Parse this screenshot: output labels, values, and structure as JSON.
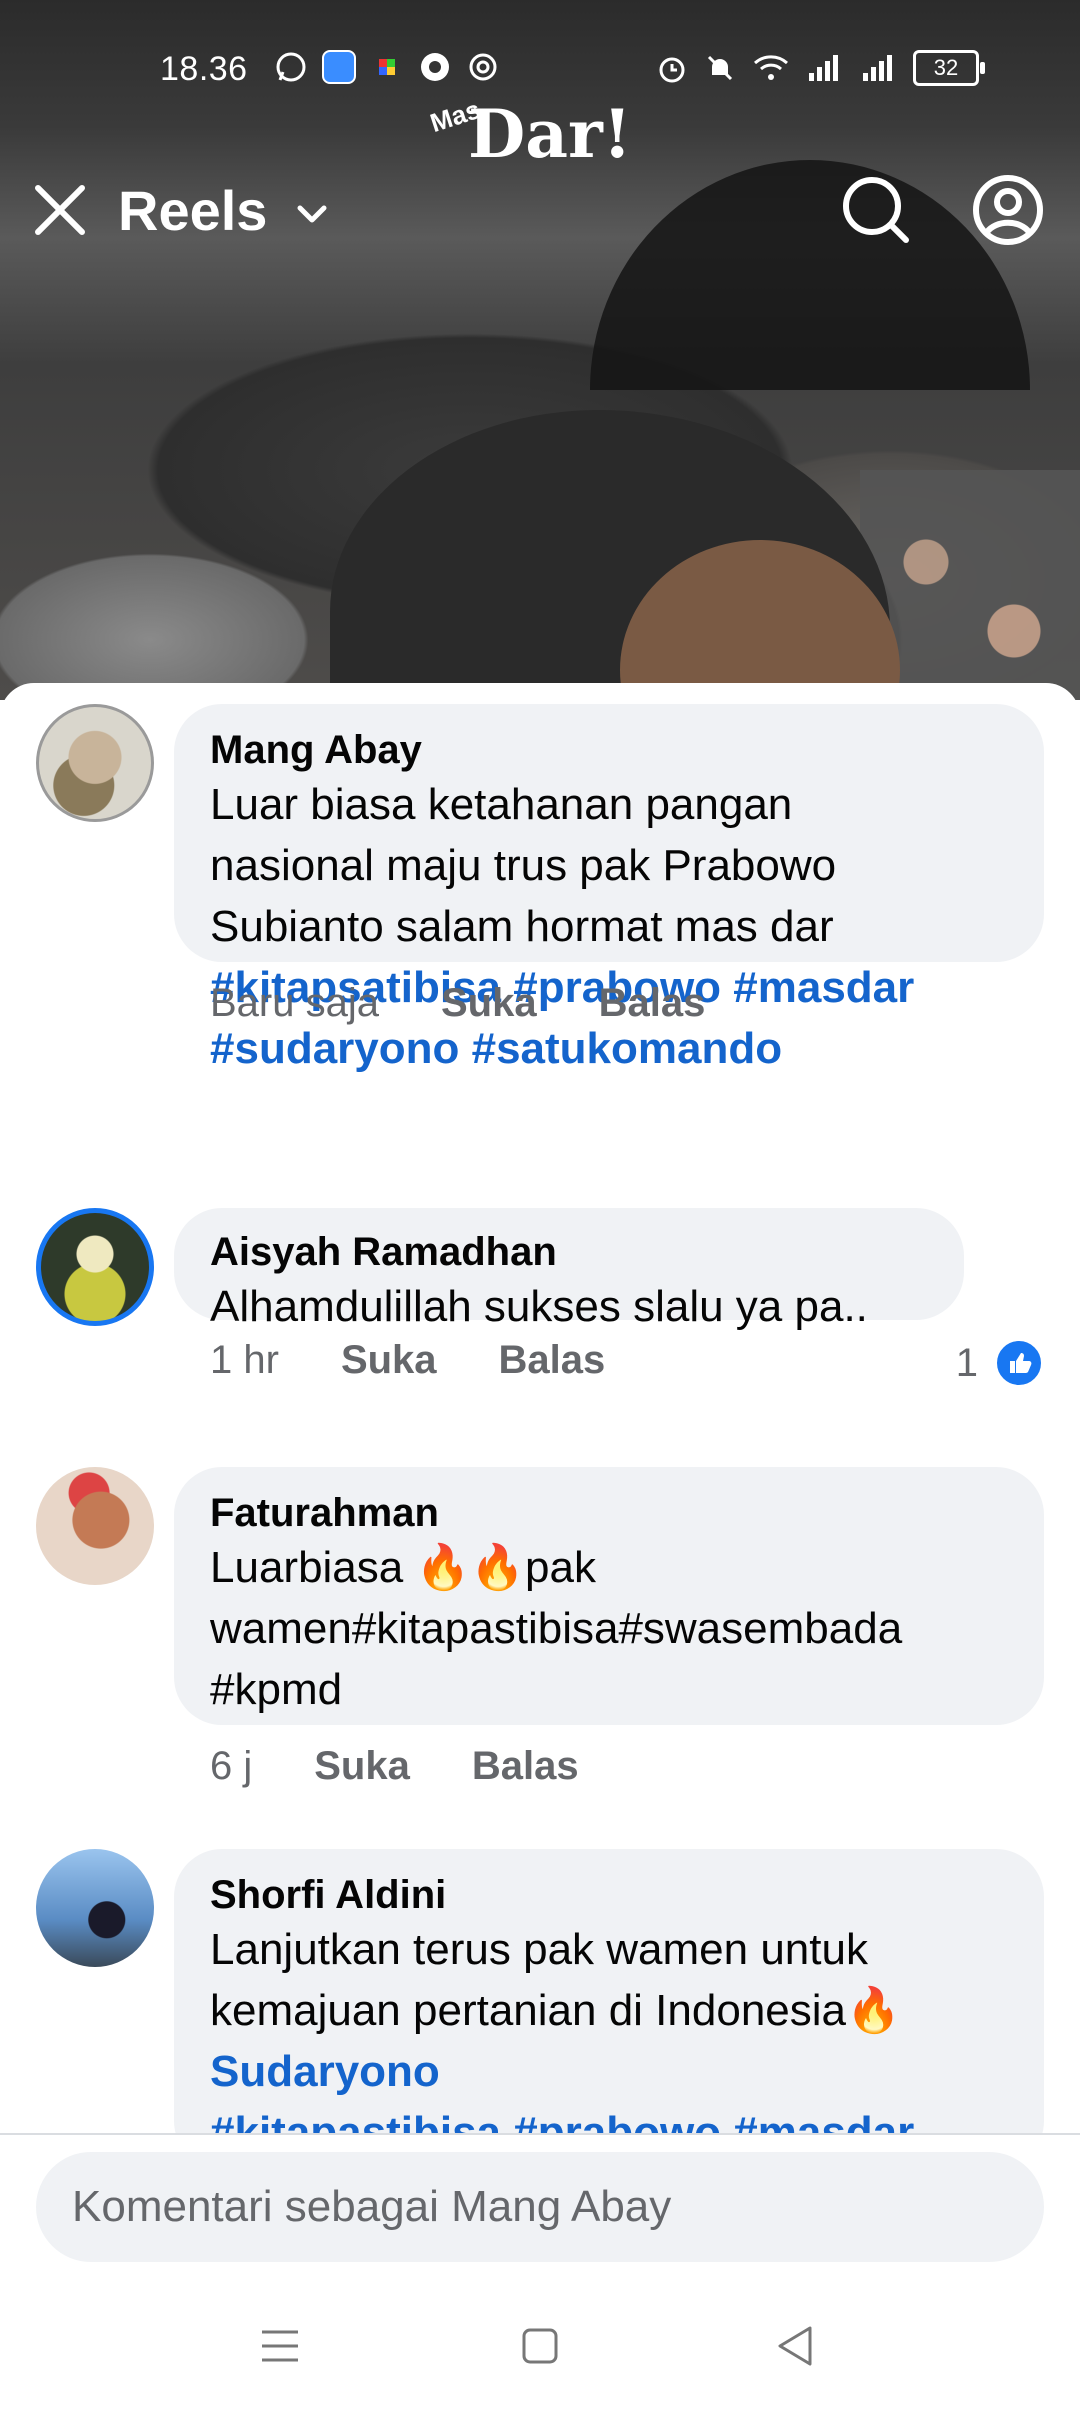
{
  "status_bar": {
    "time": "18.36",
    "battery": "32"
  },
  "logo": {
    "small": "Mas",
    "main": "Dar!"
  },
  "header": {
    "title": "Reels"
  },
  "comments": [
    {
      "author": "Mang Abay",
      "text": "Luar biasa ketahanan pangan\nnasional maju trus pak Prabowo\nSubianto salam hormat mas dar",
      "tags": "#kitapsatibisa #prabowo #masdar\n#sudaryono #satukomando",
      "time": "Baru saja",
      "like": "Suka",
      "reply": "Balas"
    },
    {
      "author": "Aisyah Ramadhan",
      "text": "Alhamdulillah sukses slalu ya pa..",
      "time": "1 hr",
      "like": "Suka",
      "reply": "Balas",
      "reaction_count": "1"
    },
    {
      "author": "Faturahman",
      "text": "Luarbiasa 🔥🔥pak\nwamen#kitapastibisa#swasembada\n#kpmd",
      "time": "6 j",
      "like": "Suka",
      "reply": "Balas"
    },
    {
      "author": "Shorfi Aldini",
      "text": "Lanjutkan terus pak wamen untuk\nkemajuan pertanian di Indonesia🔥",
      "mention": "Sudaryono",
      "tags": "#kitapastibisa #prabowo #masdar"
    }
  ],
  "input": {
    "placeholder": "Komentari sebagai Mang Abay"
  },
  "colors": {
    "link": "#1464cc",
    "bubble": "#f0f2f5",
    "like_badge": "#1877f2"
  }
}
